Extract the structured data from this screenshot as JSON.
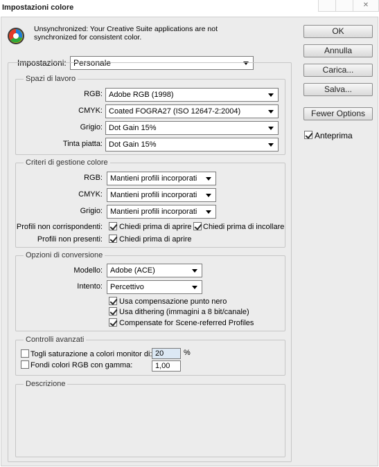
{
  "window": {
    "title": "Impostazioni colore"
  },
  "sync_message": "Unsynchronized: Your Creative Suite applications are not synchronized for consistent color.",
  "settings": {
    "label": "Impostazioni:",
    "value": "Personale"
  },
  "workspaces": {
    "title": "Spazi di lavoro",
    "rgb_label": "RGB:",
    "rgb_value": "Adobe RGB (1998)",
    "cmyk_label": "CMYK:",
    "cmyk_value": "Coated FOGRA27 (ISO 12647-2:2004)",
    "gray_label": "Grigio:",
    "gray_value": "Dot Gain 15%",
    "spot_label": "Tinta piatta:",
    "spot_value": "Dot Gain 15%"
  },
  "policies": {
    "title": "Criteri di gestione colore",
    "rgb_label": "RGB:",
    "rgb_value": "Mantieni profili incorporati",
    "cmyk_label": "CMYK:",
    "cmyk_value": "Mantieni profili incorporati",
    "gray_label": "Grigio:",
    "gray_value": "Mantieni profili incorporati",
    "mismatch_label": "Profili non corrispondenti:",
    "ask_open": "Chiedi prima di aprire",
    "ask_paste": "Chiedi prima di incollare",
    "missing_label": "Profili non presenti:",
    "ask_open_missing": "Chiedi prima di aprire"
  },
  "conversion": {
    "title": "Opzioni di conversione",
    "engine_label": "Modello:",
    "engine_value": "Adobe (ACE)",
    "intent_label": "Intento:",
    "intent_value": "Percettivo",
    "bpc": "Usa compensazione punto nero",
    "dither": "Usa dithering (immagini a 8 bit/canale)",
    "scene": "Compensate for Scene-referred Profiles"
  },
  "advanced": {
    "title": "Controlli avanzati",
    "desaturate_label": "Togli saturazione a colori monitor di:",
    "desaturate_value": "20",
    "percent": "%",
    "blend_label": "Fondi colori RGB con gamma:",
    "blend_value": "1,00"
  },
  "description": {
    "title": "Descrizione"
  },
  "buttons": {
    "ok": "OK",
    "cancel": "Annulla",
    "load": "Carica...",
    "save": "Salva...",
    "fewer": "Fewer Options"
  },
  "preview": {
    "label": "Anteprima"
  },
  "colors": {
    "panel": "#ececec",
    "border": "#c6c6c6"
  }
}
